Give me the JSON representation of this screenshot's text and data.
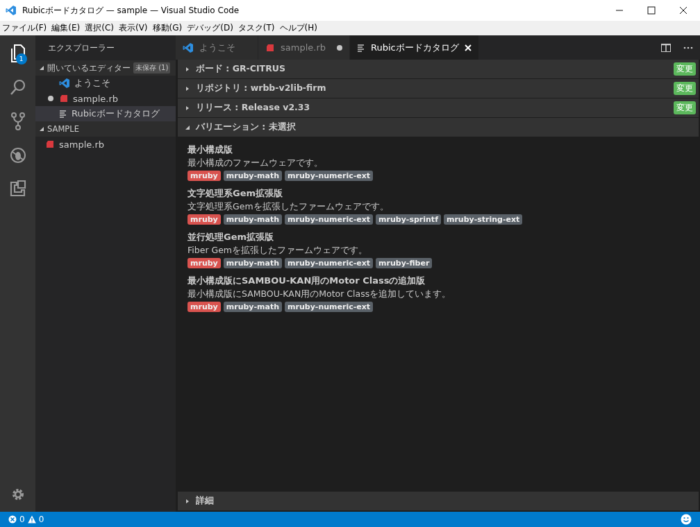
{
  "window": {
    "title": "Rubicボードカタログ — sample — Visual Studio Code"
  },
  "menu": [
    "ファイル(F)",
    "編集(E)",
    "選択(C)",
    "表示(V)",
    "移動(G)",
    "デバッグ(D)",
    "タスク(T)",
    "ヘルプ(H)"
  ],
  "activity_bar": {
    "explorer_badge": "1"
  },
  "sidebar": {
    "title": "エクスプローラー",
    "open_editors": {
      "title": "開いているエディター",
      "badge": "未保存 (1)",
      "expanded": true,
      "items": [
        {
          "kind": "vscode",
          "label": "ようこそ",
          "modified": false,
          "selected": false
        },
        {
          "kind": "ruby",
          "label": "sample.rb",
          "modified": true,
          "selected": false
        },
        {
          "kind": "preview",
          "label": "Rubicボードカタログ",
          "modified": false,
          "selected": true
        }
      ]
    },
    "folder": {
      "title": "SAMPLE",
      "expanded": true,
      "items": [
        {
          "kind": "ruby",
          "label": "sample.rb"
        }
      ]
    }
  },
  "tabs": [
    {
      "kind": "vscode",
      "label": "ようこそ",
      "selected": false,
      "modified": false
    },
    {
      "kind": "ruby",
      "label": "sample.rb",
      "selected": false,
      "modified": true
    },
    {
      "kind": "preview",
      "label": "Rubicボードカタログ",
      "selected": true,
      "modified": false
    }
  ],
  "sections": [
    {
      "label": "ボード : GR-CITRUS",
      "expanded": false,
      "button": "変更"
    },
    {
      "label": "リポジトリ : wrbb-v2lib-firm",
      "expanded": false,
      "button": "変更"
    },
    {
      "label": "リリース : Release v2.33",
      "expanded": false,
      "button": "変更"
    },
    {
      "label": "バリエーション : 未選択",
      "expanded": true
    }
  ],
  "variations": [
    {
      "title": "最小構成版",
      "description": "最小構成のファームウェアです。",
      "tags": [
        {
          "label": "mruby",
          "kind": "core"
        },
        {
          "label": "mruby-math",
          "kind": "gem"
        },
        {
          "label": "mruby-numeric-ext",
          "kind": "gem"
        }
      ]
    },
    {
      "title": "文字処理系Gem拡張版",
      "description": "文字処理系Gemを拡張したファームウェアです。",
      "tags": [
        {
          "label": "mruby",
          "kind": "core"
        },
        {
          "label": "mruby-math",
          "kind": "gem"
        },
        {
          "label": "mruby-numeric-ext",
          "kind": "gem"
        },
        {
          "label": "mruby-sprintf",
          "kind": "gem"
        },
        {
          "label": "mruby-string-ext",
          "kind": "gem"
        }
      ]
    },
    {
      "title": "並行処理Gem拡張版",
      "description": "Fiber Gemを拡張したファームウェアです。",
      "tags": [
        {
          "label": "mruby",
          "kind": "core"
        },
        {
          "label": "mruby-math",
          "kind": "gem"
        },
        {
          "label": "mruby-numeric-ext",
          "kind": "gem"
        },
        {
          "label": "mruby-fiber",
          "kind": "gem"
        }
      ]
    },
    {
      "title": "最小構成版にSAMBOU-KAN用のMotor Classの追加版",
      "description": "最小構成版にSAMBOU-KAN用のMotor Classを追加しています。",
      "tags": [
        {
          "label": "mruby",
          "kind": "core"
        },
        {
          "label": "mruby-math",
          "kind": "gem"
        },
        {
          "label": "mruby-numeric-ext",
          "kind": "gem"
        }
      ]
    }
  ],
  "details": {
    "label": "詳細",
    "expanded": false
  },
  "status_bar": {
    "errors": "0",
    "warnings": "0"
  }
}
